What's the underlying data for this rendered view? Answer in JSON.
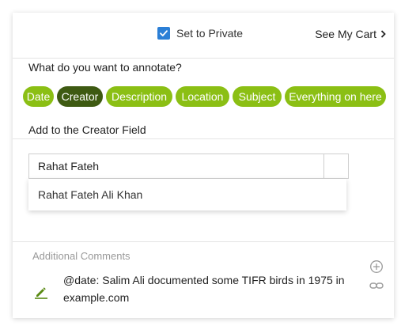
{
  "header": {
    "private_label": "Set to Private",
    "private_checked": true,
    "cart_label": "See My Cart",
    "accent_color": "#2b7fd6"
  },
  "annotate": {
    "question": "What do you want to annotate?",
    "chip_color": "#8bbf14",
    "active_chip_color": "#3e5a12",
    "chips": [
      {
        "label": "Date",
        "active": false
      },
      {
        "label": "Creator",
        "active": true
      },
      {
        "label": "Description",
        "active": false
      },
      {
        "label": "Location",
        "active": false
      },
      {
        "label": "Subject",
        "active": false
      },
      {
        "label": "Everything on here",
        "active": false
      }
    ]
  },
  "field": {
    "section_label": "Add to the Creator Field",
    "input_value": "Rahat Fateh",
    "suggestions": [
      "Rahat Fateh Ali Khan"
    ]
  },
  "comments": {
    "title": "Additional Comments",
    "items": [
      {
        "text": "@date: Salim Ali documented some TIFR birds in 1975 in example.com"
      }
    ],
    "icons": [
      "pencil-icon",
      "plus-circle-icon",
      "link-icon"
    ]
  }
}
